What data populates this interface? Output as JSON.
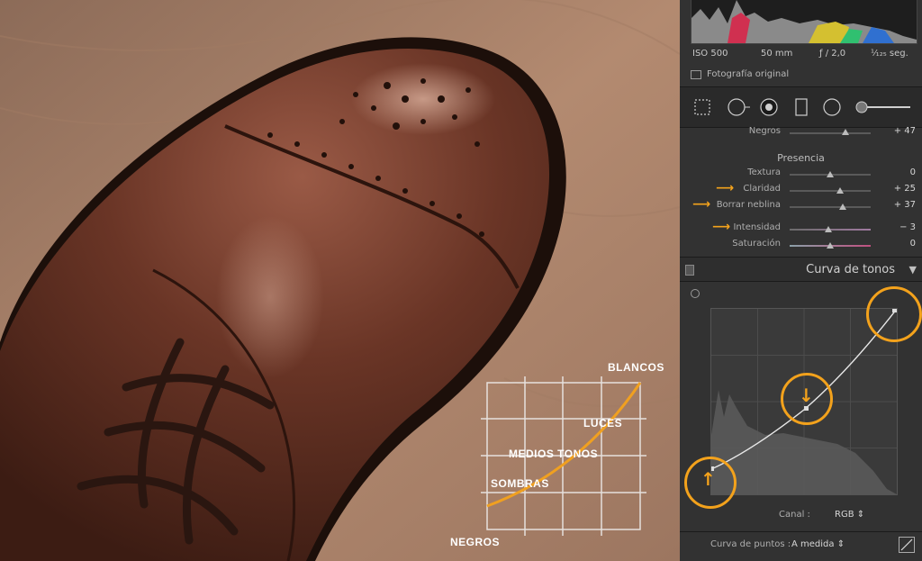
{
  "overlay": {
    "blancos": "BLANCOS",
    "luces": "LUCES",
    "medios_tonos": "MEDIOS TONOS",
    "sombras": "SOMBRAS",
    "negros": "NEGROS"
  },
  "exif": {
    "iso": "ISO 500",
    "focal": "50 mm",
    "aperture": "ƒ / 2,0",
    "shutter": "¹⁄₁₂₅ seg."
  },
  "original_photo_label": "Fotografía original",
  "basic": {
    "negros_label": "Negros",
    "negros_value": "+ 47",
    "presencia_title": "Presencia",
    "sliders": [
      {
        "label": "Textura",
        "value": "0",
        "level": 0.5
      },
      {
        "label": "Claridad",
        "value": "+ 25",
        "level": 0.62
      },
      {
        "label": "Borrar neblina",
        "value": "+ 37",
        "level": 0.66
      },
      {
        "label": "Intensidad",
        "value": "− 3",
        "level": 0.48
      },
      {
        "label": "Saturación",
        "value": "0",
        "level": 0.5
      }
    ]
  },
  "tone_curve": {
    "title": "Curva de tonos",
    "channel_label": "Canal :",
    "channel_value": "RGB",
    "point_curve_label": "Curva de puntos :",
    "point_curve_value": "A medida"
  },
  "colors": {
    "accent": "#f3a21c",
    "panel": "#323232",
    "panel_dark": "#262626"
  }
}
